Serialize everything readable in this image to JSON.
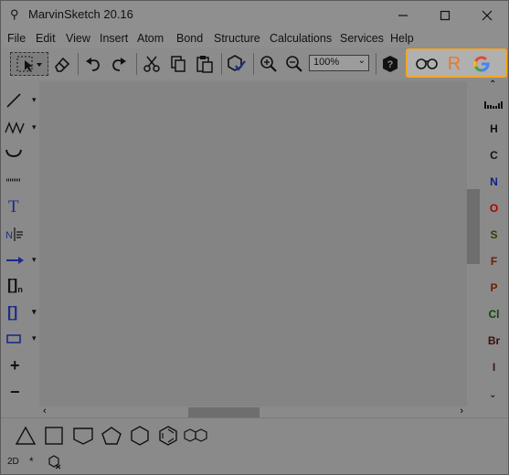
{
  "window": {
    "title": "MarvinSketch 20.16",
    "minimize_icon": "minimize-icon",
    "maximize_icon": "maximize-icon",
    "close_icon": "close-icon"
  },
  "menu": [
    "File",
    "Edit",
    "View",
    "Insert",
    "Atom",
    "Bond",
    "Structure",
    "Calculations",
    "Services",
    "Help"
  ],
  "toolbar": {
    "zoom_value": "100%",
    "highlight_color": "#f5a623",
    "r_label": "R",
    "r_color": "#e8792b",
    "g_label": "G",
    "icons": [
      "select-icon",
      "eraser-icon",
      "undo-icon",
      "redo-icon",
      "cut-icon",
      "copy-icon",
      "paste-icon",
      "clean-icon",
      "zoom-in-icon",
      "zoom-out-icon",
      "help-icon",
      "glasses-icon",
      "r-icon",
      "g-icon"
    ]
  },
  "left_tools": {
    "text_label": "T",
    "bracket_label": "[]",
    "bracket_sub": "n",
    "bracket2_label": "[]",
    "plus_label": "+",
    "minus_label": "−",
    "icons": [
      "single-bond-icon",
      "chain-icon",
      "ring-bond-icon",
      "dashed-bond-icon",
      "text-icon",
      "atom-label-icon",
      "arrow-icon",
      "bracket-n-icon",
      "bracket-icon",
      "rectangle-icon",
      "plus-icon",
      "minus-icon"
    ]
  },
  "elements": [
    {
      "symbol": "H",
      "color": "#111111"
    },
    {
      "symbol": "C",
      "color": "#111111"
    },
    {
      "symbol": "N",
      "color": "#0b1f8a"
    },
    {
      "symbol": "O",
      "color": "#b00000"
    },
    {
      "symbol": "S",
      "color": "#3d3a00"
    },
    {
      "symbol": "F",
      "color": "#6b1f00"
    },
    {
      "symbol": "P",
      "color": "#6b1f00"
    },
    {
      "symbol": "Cl",
      "color": "#0d4a0d"
    },
    {
      "symbol": "Br",
      "color": "#3a0f0f"
    },
    {
      "symbol": "I",
      "color": "#3a0f3a"
    }
  ],
  "shapes": [
    "triangle-icon",
    "square-icon",
    "pentagon-open-icon",
    "pentagon-icon",
    "hexagon-icon",
    "benzene-icon",
    "naphthalene-icon"
  ],
  "status": {
    "mode": "2D",
    "star": "*",
    "icon": "mol-settings-icon"
  }
}
